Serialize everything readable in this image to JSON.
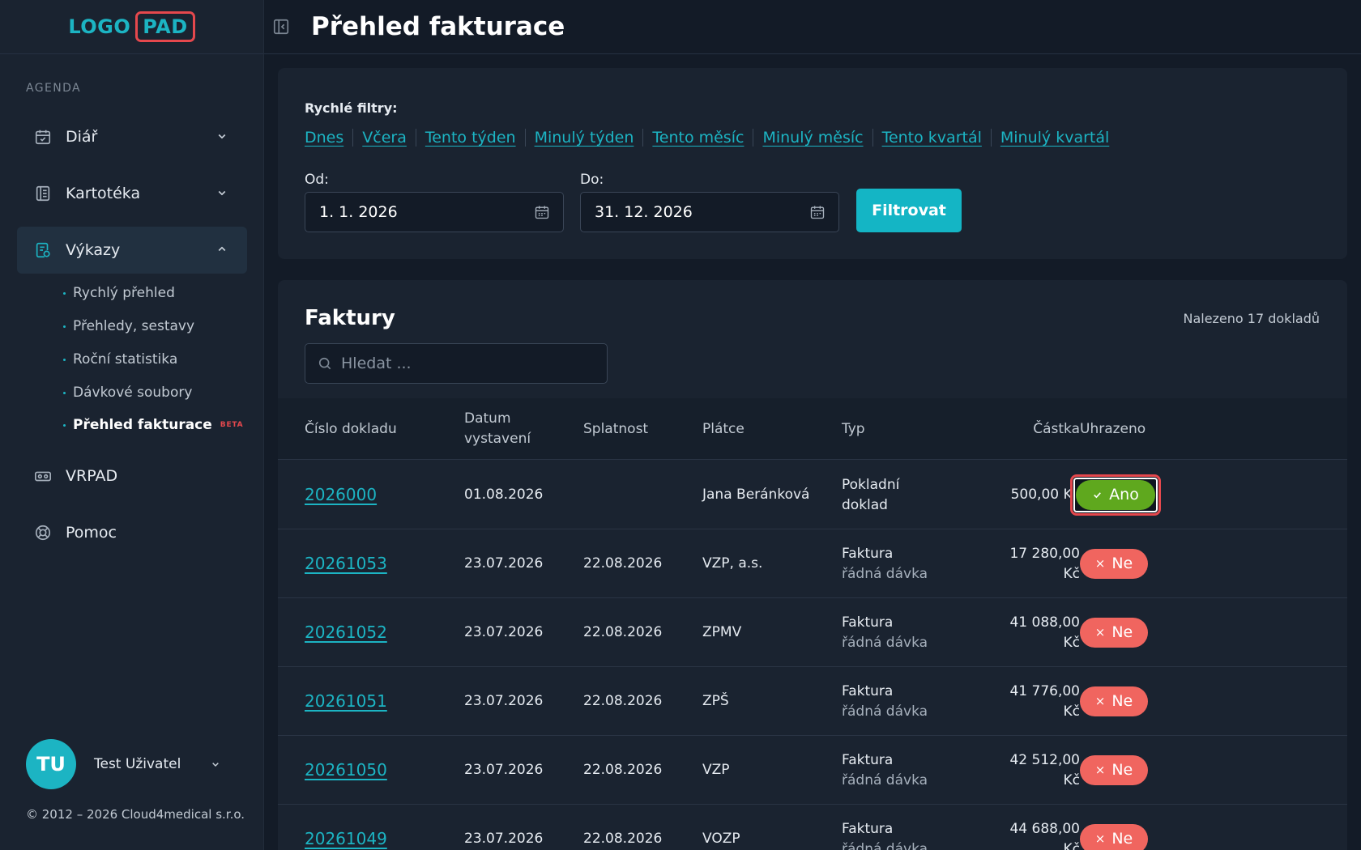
{
  "logo": {
    "left": "LOGO",
    "right": "PAD"
  },
  "sidebar": {
    "section_label": "AGENDA",
    "items": [
      {
        "label": "Diář",
        "icon": "calendar-check-icon"
      },
      {
        "label": "Kartotéka",
        "icon": "folder-list-icon"
      },
      {
        "label": "Výkazy",
        "icon": "report-icon"
      },
      {
        "label": "VRPAD",
        "icon": "vr-headset-icon"
      },
      {
        "label": "Pomoc",
        "icon": "lifebuoy-icon"
      }
    ],
    "subitems": [
      {
        "label": "Rychlý přehled"
      },
      {
        "label": "Přehledy, sestavy"
      },
      {
        "label": "Roční statistika"
      },
      {
        "label": "Dávkové soubory"
      },
      {
        "label": "Přehled fakturace",
        "badge": "BETA"
      }
    ],
    "user": {
      "initials": "TU",
      "name": "Test Uživatel"
    },
    "copyright": "© 2012 – 2026 Cloud4medical s.r.o."
  },
  "header": {
    "title": "Přehled fakturace"
  },
  "filters": {
    "title": "Rychlé filtry:",
    "quick": [
      "Dnes",
      "Včera",
      "Tento týden",
      "Minulý týden",
      "Tento měsíc",
      "Minulý měsíc",
      "Tento kvartál",
      "Minulý kvartál"
    ],
    "from_label": "Od:",
    "from_value": "1. 1. 2026",
    "to_label": "Do:",
    "to_value": "31. 12. 2026",
    "button": "Filtrovat"
  },
  "invoices": {
    "title": "Faktury",
    "found": "Nalezeno 17 dokladů",
    "search_placeholder": "Hledat ...",
    "columns": {
      "number": "Číslo dokladu",
      "issued_1": "Datum",
      "issued_2": "vystavení",
      "due": "Splatnost",
      "payer": "Plátce",
      "type": "Typ",
      "amount": "Částka",
      "paid": "Uhrazeno"
    },
    "rows": [
      {
        "number": "2026000",
        "issued": "01.08.2026",
        "due": "",
        "payer": "Jana Beránková",
        "type1": "Pokladní",
        "type2": "doklad",
        "amount1": "500,00 Kč",
        "amount2": "",
        "paid": "Ano",
        "paid_state": "yes"
      },
      {
        "number": "20261053",
        "issued": "23.07.2026",
        "due": "22.08.2026",
        "payer": "VZP, a.s.",
        "type1": "Faktura",
        "type2": "řádná dávka",
        "amount1": "17 280,00",
        "amount2": "Kč",
        "paid": "Ne",
        "paid_state": "no"
      },
      {
        "number": "20261052",
        "issued": "23.07.2026",
        "due": "22.08.2026",
        "payer": "ZPMV",
        "type1": "Faktura",
        "type2": "řádná dávka",
        "amount1": "41 088,00",
        "amount2": "Kč",
        "paid": "Ne",
        "paid_state": "no"
      },
      {
        "number": "20261051",
        "issued": "23.07.2026",
        "due": "22.08.2026",
        "payer": "ZPŠ",
        "type1": "Faktura",
        "type2": "řádná dávka",
        "amount1": "41 776,00",
        "amount2": "Kč",
        "paid": "Ne",
        "paid_state": "no"
      },
      {
        "number": "20261050",
        "issued": "23.07.2026",
        "due": "22.08.2026",
        "payer": "VZP",
        "type1": "Faktura",
        "type2": "řádná dávka",
        "amount1": "42 512,00",
        "amount2": "Kč",
        "paid": "Ne",
        "paid_state": "no"
      },
      {
        "number": "20261049",
        "issued": "23.07.2026",
        "due": "22.08.2026",
        "payer": "VOZP",
        "type1": "Faktura",
        "type2": "řádná dávka",
        "amount1": "44 688,00",
        "amount2": "Kč",
        "paid": "Ne",
        "paid_state": "no"
      }
    ]
  },
  "colors": {
    "accent": "#1cb4c3",
    "paid_yes": "#5fa81e",
    "paid_no": "#f0655f",
    "highlight": "#e5484d"
  }
}
